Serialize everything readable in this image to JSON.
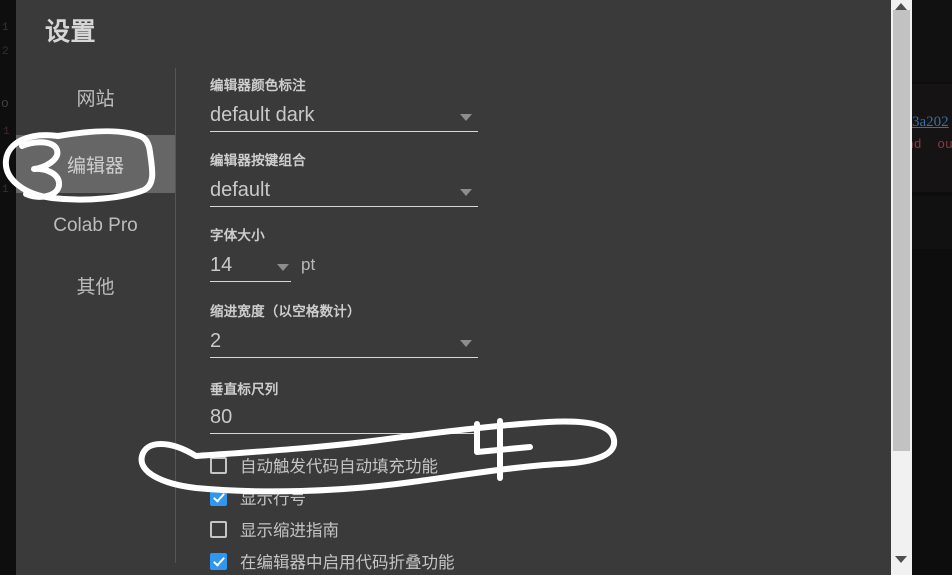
{
  "dialog": {
    "title": "设置"
  },
  "sidebar": {
    "items": [
      {
        "label": "网站",
        "selected": false
      },
      {
        "label": "编辑器",
        "selected": true
      },
      {
        "label": "Colab Pro",
        "selected": false
      },
      {
        "label": "其他",
        "selected": false
      }
    ]
  },
  "form": {
    "fields": [
      {
        "label": "编辑器颜色标注",
        "value": "default dark",
        "control": "dropdown",
        "suffix": ""
      },
      {
        "label": "编辑器按键组合",
        "value": "default",
        "control": "dropdown",
        "suffix": ""
      },
      {
        "label": "字体大小",
        "value": "14",
        "control": "dropdown",
        "suffix": "pt"
      },
      {
        "label": "缩进宽度（以空格数计）",
        "value": "2",
        "control": "dropdown",
        "suffix": ""
      },
      {
        "label": "垂直标尺列",
        "value": "80",
        "control": "text",
        "suffix": ""
      }
    ],
    "checkboxes": [
      {
        "label": "自动触发代码自动填充功能",
        "checked": false
      },
      {
        "label": "显示行号",
        "checked": true
      },
      {
        "label": "显示缩进指南",
        "checked": false
      },
      {
        "label": "在编辑器中启用代码折叠功能",
        "checked": true
      }
    ]
  },
  "scrollbar": {
    "up_arrow": "scroll-up-arrow",
    "down_arrow": "scroll-down-arrow"
  },
  "background": {
    "link_text": "3a202",
    "error_text": "nd  ou",
    "code_fragments": [
      "1",
      "2",
      "o",
      "1",
      "1"
    ]
  },
  "annotations": [
    {
      "name": "handwritten-3",
      "text": "3"
    },
    {
      "name": "handwritten-4",
      "text": "4"
    }
  ],
  "colors": {
    "dialog_bg": "#3a3a3a",
    "selected_nav_bg": "#666666",
    "checkbox_blue": "#2f97f0",
    "annotation_ink": "#ffffff",
    "page_bg": "#0d0d0d"
  }
}
